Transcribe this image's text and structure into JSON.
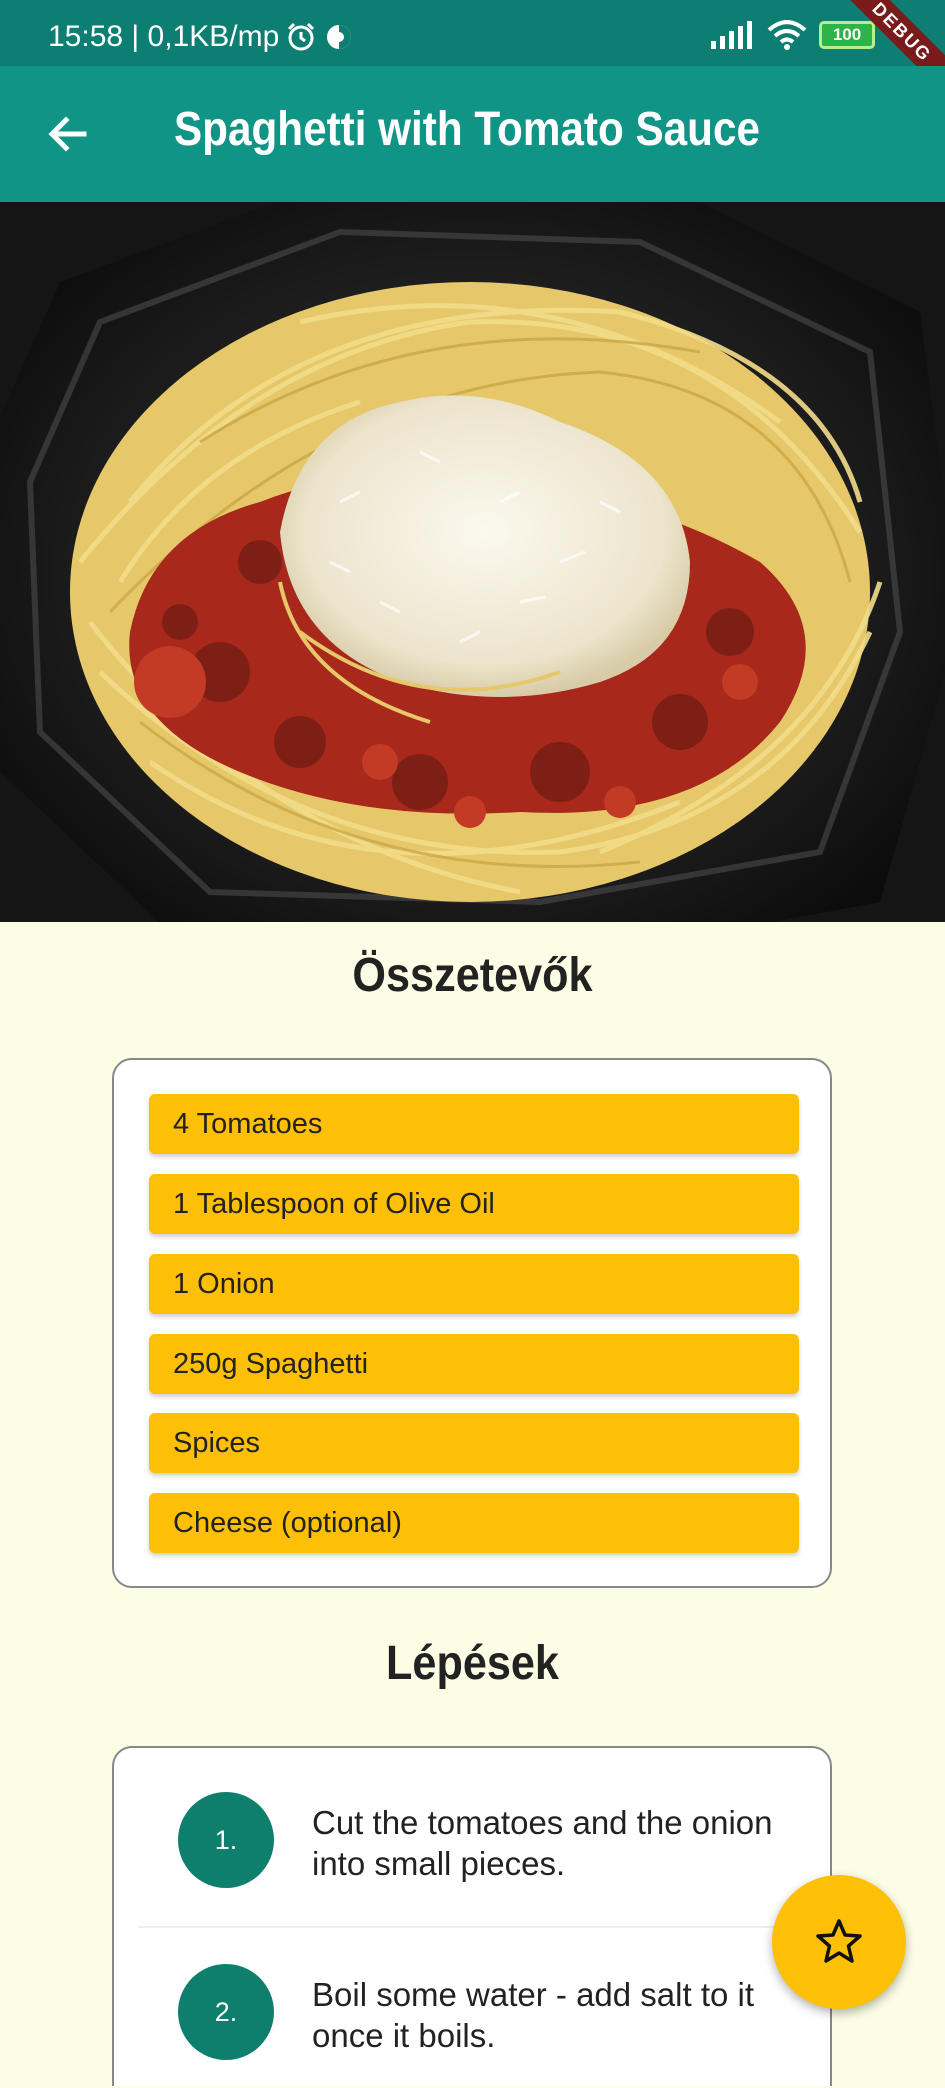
{
  "status_bar": {
    "time_info": "15:58 | 0,1KB/mp",
    "battery": "100",
    "debug_label": "DEBUG"
  },
  "app_bar": {
    "title": "Spaghetti with Tomato Sauce"
  },
  "ingredients": {
    "heading": "Összetevők",
    "items": [
      "4 Tomatoes",
      "1 Tablespoon of Olive Oil",
      "1 Onion",
      "250g Spaghetti",
      "Spices",
      "Cheese (optional)"
    ]
  },
  "steps": {
    "heading": "Lépések",
    "items": [
      {
        "number": "1.",
        "text": "Cut the tomatoes and the onion into small pieces."
      },
      {
        "number": "2.",
        "text": "Boil some water - add salt to it once it boils."
      }
    ]
  },
  "fab": {
    "icon": "star-outline-icon"
  },
  "colors": {
    "primary": "#0f9486",
    "status_bar": "#0d7f72",
    "accent": "#fdc007",
    "background": "#fcfde5",
    "step_circle": "#0f7f6d"
  }
}
